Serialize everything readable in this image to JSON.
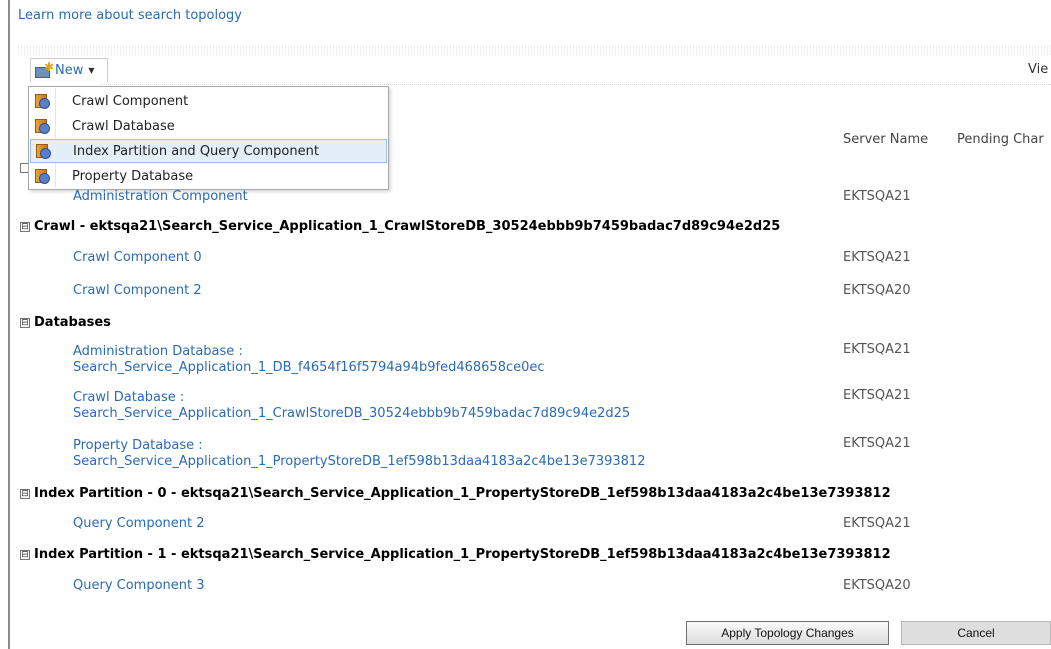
{
  "learn_more": "Learn more about search topology",
  "toolbar": {
    "new_label": "New",
    "view_label": "Vie"
  },
  "menu": {
    "items": [
      {
        "label": "Crawl Component"
      },
      {
        "label": "Crawl Database"
      },
      {
        "label": "Index Partition and Query Component",
        "highlighted": true
      },
      {
        "label": "Property Database"
      }
    ]
  },
  "columns": {
    "server": "Server Name",
    "pending": "Pending Char"
  },
  "groups": {
    "admin": {
      "item": "Administration Component",
      "server": "EKTSQA21"
    },
    "crawl": {
      "title": "Crawl - ektsqa21\\Search_Service_Application_1_CrawlStoreDB_30524ebbb9b7459badac7d89c94e2d25",
      "items": [
        {
          "name": "Crawl Component 0",
          "server": "EKTSQA21"
        },
        {
          "name": "Crawl Component 2",
          "server": "EKTSQA20"
        }
      ]
    },
    "databases": {
      "title": "Databases",
      "items": [
        {
          "line1": "Administration Database :",
          "line2": "Search_Service_Application_1_DB_f4654f16f5794a94b9fed468658ce0ec",
          "server": "EKTSQA21"
        },
        {
          "line1": "Crawl Database :",
          "line2": "Search_Service_Application_1_CrawlStoreDB_30524ebbb9b7459badac7d89c94e2d25",
          "server": "EKTSQA21"
        },
        {
          "line1": "Property Database :",
          "line2": "Search_Service_Application_1_PropertyStoreDB_1ef598b13daa4183a2c4be13e7393812",
          "server": "EKTSQA21"
        }
      ]
    },
    "index0": {
      "title": "Index Partition - 0 - ektsqa21\\Search_Service_Application_1_PropertyStoreDB_1ef598b13daa4183a2c4be13e7393812",
      "items": [
        {
          "name": "Query Component 2",
          "server": "EKTSQA21"
        }
      ]
    },
    "index1": {
      "title": "Index Partition - 1 - ektsqa21\\Search_Service_Application_1_PropertyStoreDB_1ef598b13daa4183a2c4be13e7393812",
      "items": [
        {
          "name": "Query Component 3",
          "server": "EKTSQA20"
        }
      ]
    }
  },
  "buttons": {
    "apply": "Apply Topology Changes",
    "cancel": "Cancel"
  },
  "toggle_glyph": "⊟",
  "colors": {
    "link": "#2a6bb5",
    "menu_highlight": "#e4eef9"
  }
}
